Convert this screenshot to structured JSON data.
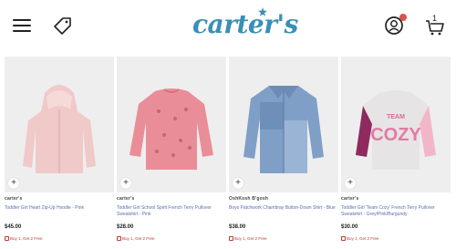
{
  "header": {
    "logo_text": "carter's",
    "cart_count": "1",
    "colors": {
      "logo": "#3a8fb6",
      "notification_dot": "#d9534f"
    }
  },
  "products": [
    {
      "brand": "carter's",
      "title": "Toddler Girl Heart Zip-Up Hoodie - Pink",
      "price": "$45.00",
      "promo": "Buy 1, Get 2 Free",
      "color": "#f0c9c9"
    },
    {
      "brand": "carter's",
      "title": "Toddler Girl School Spirit French Terry Pullover Sweatshirt - Pink",
      "price": "$28.00",
      "promo": "Buy 1, Get 2 Free",
      "color": "#e98e98"
    },
    {
      "brand": "OshKosh B'gosh",
      "title": "Boys Patchwork Chambray Button-Down Shirt - Blue",
      "price": "$38.00",
      "promo": "Buy 1, Get 2 Free",
      "color": "#7f9fc7"
    },
    {
      "brand": "carter's",
      "title": "Toddler Girl 'Team Cozy' French Terry Pullover Sweatshirt - Grey/Pink/Burgundy",
      "price": "$30.00",
      "promo": "Buy 1, Get 2 Free",
      "color": "#e6e4e5",
      "print_text": [
        "TEAM",
        "COZY"
      ]
    }
  ]
}
